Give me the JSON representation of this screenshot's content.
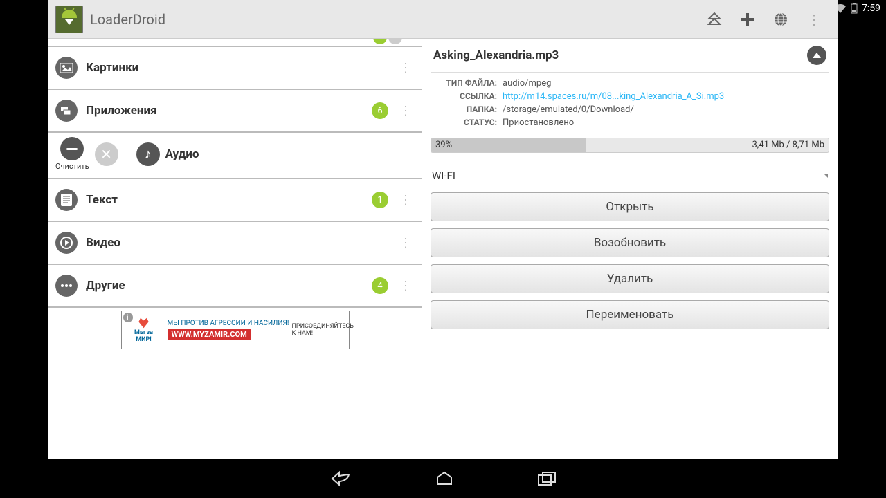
{
  "statusbar": {
    "time": "7:59"
  },
  "app": {
    "title": "LoaderDroid"
  },
  "categories": [
    {
      "icon": "image",
      "label": "Картинки",
      "badge": null
    },
    {
      "icon": "apps",
      "label": "Приложения",
      "badge": "6"
    },
    {
      "icon": "text",
      "label": "Текст",
      "badge": "1"
    },
    {
      "icon": "video",
      "label": "Видео",
      "badge": null
    },
    {
      "icon": "other",
      "label": "Другие",
      "badge": "4"
    }
  ],
  "audio": {
    "clear": "Очистить",
    "label": "Аудио"
  },
  "ad": {
    "slogan1": "Мы за",
    "slogan2": "МИР!",
    "headline": "МЫ ПРОТИВ АГРЕССИИ И НАСИЛИЯ!",
    "cta": "ПРИСОЕДИНЯЙТЕСЬ К НАМ!",
    "url": "WWW.MYZAMIR.COM"
  },
  "detail": {
    "filename": "Asking_Alexandria.mp3",
    "meta": {
      "filetype_key": "ТИП ФАЙЛА:",
      "filetype_val": "audio/mpeg",
      "link_key": "ССЫЛКА:",
      "link_val": "http://m14.spaces.ru/m/08...king_Alexandria_A_Si.mp3",
      "folder_key": "ПАПКА:",
      "folder_val": "/storage/emulated/0/Download/",
      "status_key": "СТАТУС:",
      "status_val": "Приостановлено"
    },
    "progress": {
      "percent": "39%",
      "percent_num": 39,
      "size": "3,41 Mb / 8,71 Mb"
    },
    "network": "WI-FI",
    "buttons": {
      "open": "Открыть",
      "resume": "Возобновить",
      "delete": "Удалить",
      "rename": "Переименовать"
    }
  }
}
